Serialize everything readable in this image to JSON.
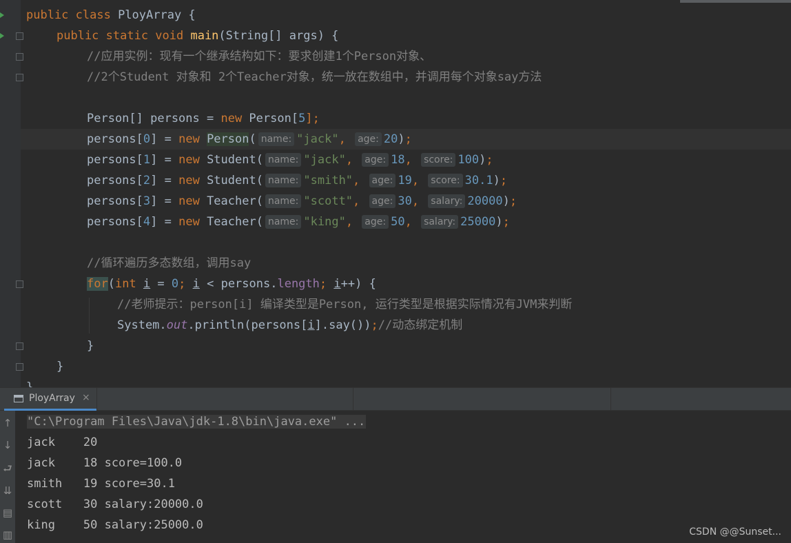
{
  "code": {
    "l1": {
      "kw": "public class ",
      "cls": "PloyArray",
      "rest": " {"
    },
    "l2": {
      "kw": "public static void ",
      "fn": "main",
      "rest": "(String[] args) {"
    },
    "l3": {
      "comment": "//应用实例：现有一个继承结构如下：要求创建1个Person对象、"
    },
    "l4": {
      "comment": "//2个Student 对象和 2个Teacher对象，统一放在数组中，并调用每个对象say方法"
    },
    "l5": {
      "a": "Person[] persons = ",
      "kw": "new",
      "b": " Person[",
      "num": "5",
      "c": "];"
    },
    "rows": [
      {
        "prefix": "persons[",
        "idx": "0",
        "mid": "] = ",
        "kw": "new",
        "cls": "Person",
        "h1": "name:",
        "s1": "\"jack\"",
        "h2": "age:",
        "n2": "20",
        "h3": "",
        "n3": ""
      },
      {
        "prefix": "persons[",
        "idx": "1",
        "mid": "] = ",
        "kw": "new",
        "cls": "Student",
        "h1": "name:",
        "s1": "\"jack\"",
        "h2": "age:",
        "n2": "18",
        "h3": "score:",
        "n3": "100"
      },
      {
        "prefix": "persons[",
        "idx": "2",
        "mid": "] = ",
        "kw": "new",
        "cls": "Student",
        "h1": "name:",
        "s1": "\"smith\"",
        "h2": "age:",
        "n2": "19",
        "h3": "score:",
        "n3": "30.1"
      },
      {
        "prefix": "persons[",
        "idx": "3",
        "mid": "] = ",
        "kw": "new",
        "cls": "Teacher",
        "h1": "name:",
        "s1": "\"scott\"",
        "h2": "age:",
        "n2": "30",
        "h3": "salary:",
        "n3": "20000"
      },
      {
        "prefix": "persons[",
        "idx": "4",
        "mid": "] = ",
        "kw": "new",
        "cls": "Teacher",
        "h1": "name:",
        "s1": "\"king\"",
        "h2": "age:",
        "n2": "50",
        "h3": "salary:",
        "n3": "25000"
      }
    ],
    "l11": {
      "comment": "//循环遍历多态数组，调用say"
    },
    "l12": {
      "kw_for": "for",
      "p1": "(",
      "kw_int": "int ",
      "v1": "i",
      "eq": " = ",
      "zero": "0",
      "semi1": "; ",
      "v2": "i",
      "lt": " < persons.",
      "fld": "length",
      "semi2": "; ",
      "v3": "i",
      "inc": "++) {"
    },
    "l13": {
      "comment": "//老师提示：person[i] 编译类型是Person, 运行类型是根据实际情况有JVM来判断"
    },
    "l14": {
      "a": "System.",
      "out": "out",
      "b": ".println(persons[",
      "v": "i",
      "c": "].say())",
      "semi": ";",
      "comment": "//动态绑定机制"
    },
    "l15": "}",
    "l16": "}",
    "l17": "}"
  },
  "run_panel": {
    "tab_label": "PloyArray",
    "close": "×"
  },
  "console": {
    "command": "\"C:\\Program Files\\Java\\jdk-1.8\\bin\\java.exe\" ...",
    "output": [
      "jack    20",
      "jack    18 score=100.0",
      "smith   19 score=30.1",
      "scott   30 salary:20000.0",
      "king    50 salary:25000.0"
    ]
  },
  "console_icons": [
    "arrow-up-icon",
    "arrow-down-icon",
    "soft-wrap-icon",
    "scroll-to-end-icon",
    "print-icon",
    "trash-icon"
  ],
  "watermark": "CSDN @@Sunset...",
  "colors": {
    "background": "#2b2b2b",
    "keyword": "#cc7832",
    "function": "#ffc66d",
    "string": "#6a8759",
    "number": "#6897bb",
    "comment": "#808080",
    "field": "#9876aa",
    "text": "#a9b7c6"
  }
}
